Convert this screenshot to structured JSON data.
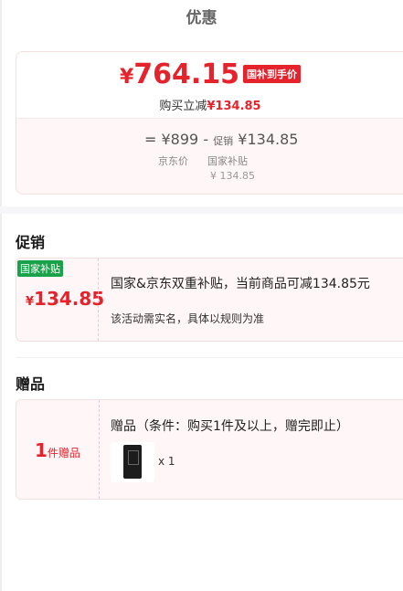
{
  "header": {
    "title": "优惠"
  },
  "price_card": {
    "currency": "¥",
    "final_price": "764.15",
    "tag": "国补到手价",
    "discount_prefix": "购买立减",
    "discount_amount": "¥134.85",
    "calc": {
      "eq": "=",
      "jd_price": "¥899",
      "minus": "-",
      "promo_label": "促销",
      "promo_amount": "¥134.85",
      "jd_label": "京东价",
      "gov_label": "国家补贴",
      "gov_amount": "¥ 134.85"
    }
  },
  "promo_section": {
    "title": "促销",
    "badge": "国家补贴",
    "currency": "¥",
    "amount": "134.85",
    "text": "国家&京东双重补贴，当前商品可减134.85元",
    "note": "该活动需实名，具体以规则为准"
  },
  "gift_section": {
    "title": "赠品",
    "count": "1",
    "unit": "件赠品",
    "text": "赠品（条件：购买1件及以上，赠完即止）",
    "quantity": "x 1"
  },
  "colors": {
    "accent": "#e4232c",
    "badge_green": "#1aa24a"
  }
}
